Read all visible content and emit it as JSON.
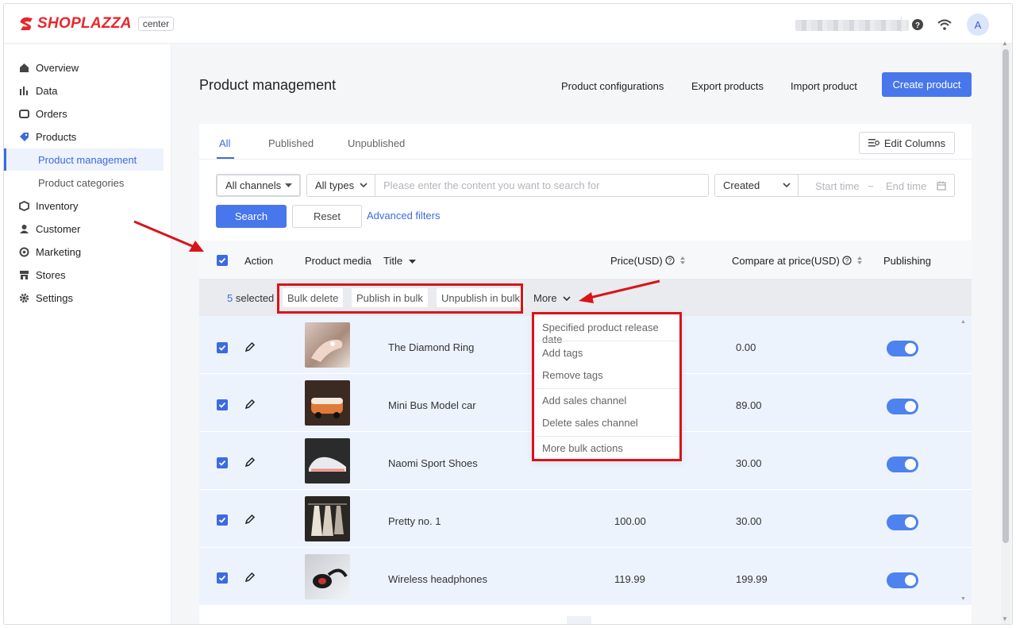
{
  "app": {
    "brand": "SHOPLAZZA",
    "badge": "center",
    "avatar": "A",
    "colors": {
      "accent": "#4876eb",
      "brand_red": "#e8272c",
      "annotation_red": "#d9131b"
    }
  },
  "sidebar": {
    "items": [
      {
        "label": "Overview",
        "icon": "home-icon"
      },
      {
        "label": "Data",
        "icon": "bar-chart-icon"
      },
      {
        "label": "Orders",
        "icon": "inbox-icon"
      },
      {
        "label": "Products",
        "icon": "tag-icon"
      },
      {
        "label": "Inventory",
        "icon": "box-icon"
      },
      {
        "label": "Customer",
        "icon": "person-icon"
      },
      {
        "label": "Marketing",
        "icon": "target-icon"
      },
      {
        "label": "Stores",
        "icon": "store-icon"
      },
      {
        "label": "Settings",
        "icon": "gear-icon"
      }
    ],
    "sub_items": [
      {
        "label": "Product management",
        "active": true
      },
      {
        "label": "Product categories",
        "active": false
      }
    ]
  },
  "header": {
    "title": "Product management",
    "buttons": {
      "configurations": "Product configurations",
      "export": "Export products",
      "import": "Import product",
      "create": "Create product"
    }
  },
  "tabs": {
    "all": "All",
    "published": "Published",
    "unpublished": "Unpublished",
    "edit_columns": "Edit Columns"
  },
  "filters": {
    "channels": "All channels",
    "types": "All types",
    "search_placeholder": "Please enter the content you want to search for",
    "sort": "Created",
    "start_time": "Start time",
    "tilde": "~",
    "end_time": "End time",
    "search_button": "Search",
    "reset_button": "Reset",
    "advanced": "Advanced filters"
  },
  "table": {
    "headers": {
      "action": "Action",
      "media": "Product media",
      "title": "Title",
      "price": "Price(USD)",
      "compare": "Compare at price(USD)",
      "publishing": "Publishing"
    },
    "rows": [
      {
        "title": "The Diamond Ring",
        "price": "",
        "compare": "0.00",
        "published": true
      },
      {
        "title": "Mini Bus Model car",
        "price": "",
        "compare": "89.00",
        "published": true
      },
      {
        "title": "Naomi Sport Shoes",
        "price": "",
        "compare": "30.00",
        "published": true
      },
      {
        "title": "Pretty no. 1",
        "price": "100.00",
        "compare": "30.00",
        "published": true
      },
      {
        "title": "Wireless headphones",
        "price": "119.99",
        "compare": "199.99",
        "published": true
      }
    ]
  },
  "bulk": {
    "count": "5",
    "selected_label": "selected",
    "delete": "Bulk delete",
    "publish": "Publish in bulk",
    "unpublish": "Unpublish in bulk",
    "more": "More"
  },
  "more_menu": {
    "items": [
      "Specified product release date",
      "Add tags",
      "Remove tags",
      "Add sales channel",
      "Delete sales channel",
      "More bulk actions"
    ]
  }
}
